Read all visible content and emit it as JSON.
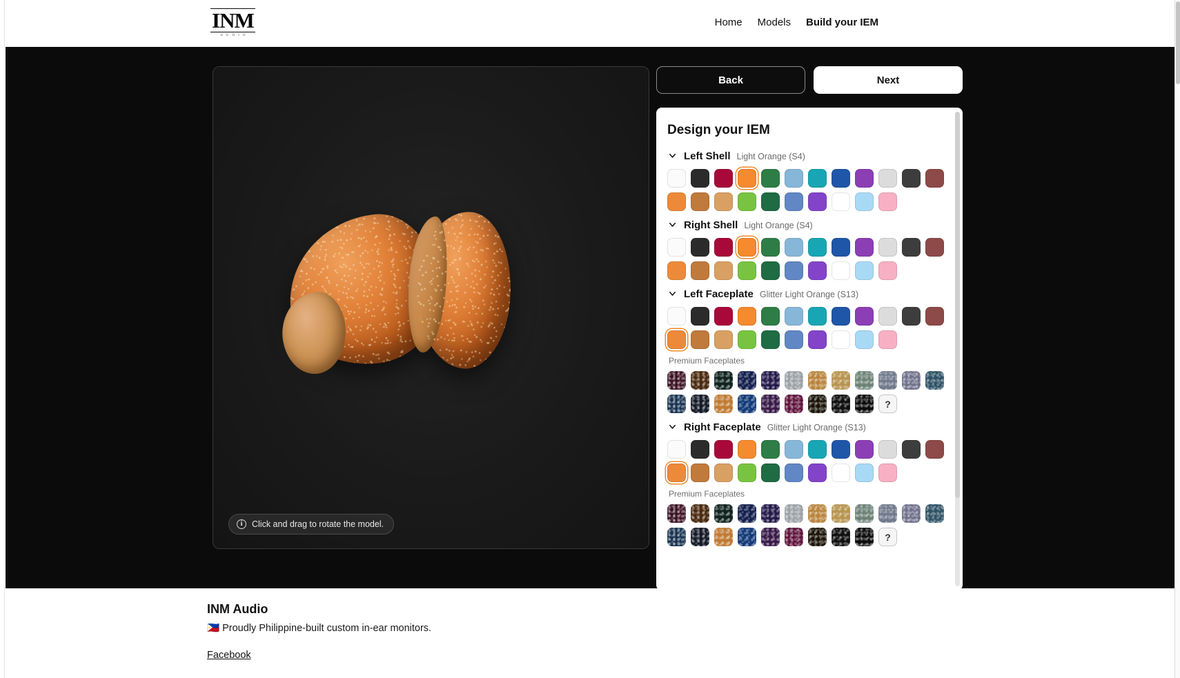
{
  "header": {
    "logo_mark": "INM",
    "logo_sub": "AUDIO",
    "nav": [
      {
        "label": "Home",
        "active": false
      },
      {
        "label": "Models",
        "active": false
      },
      {
        "label": "Build your IEM",
        "active": true
      }
    ]
  },
  "viewer": {
    "hint": "Click and drag to rotate the model.",
    "hint_icon": "info-icon",
    "model": "custom in-ear monitor pair, glitter light orange"
  },
  "controls": {
    "back_label": "Back",
    "next_label": "Next"
  },
  "panel": {
    "title": "Design your IEM",
    "premium_label": "Premium Faceplates",
    "help_label": "?",
    "sections": [
      {
        "name": "Left Shell",
        "value": "Light Orange (S4)",
        "selected_row": 0,
        "selected_index": 3,
        "has_premium": false
      },
      {
        "name": "Right Shell",
        "value": "Light Orange (S4)",
        "selected_row": 0,
        "selected_index": 3,
        "has_premium": false
      },
      {
        "name": "Left Faceplate",
        "value": "Glitter Light Orange (S13)",
        "selected_row": 1,
        "selected_index": 0,
        "has_premium": true
      },
      {
        "name": "Right Faceplate",
        "value": "Glitter Light Orange (S13)",
        "selected_row": 1,
        "selected_index": 0,
        "has_premium": true
      }
    ],
    "palette_row1": [
      "#fbfbfb",
      "#2b2b2b",
      "#a8093a",
      "#f58a2e",
      "#2f7d46",
      "#86b7d8",
      "#18a6b4",
      "#1f56a8",
      "#8c3fb5",
      "#dcdcdc",
      "#3d3d3d",
      "#8d4a48"
    ],
    "palette_row2": [
      "#ed8a3a",
      "#bf7a3c",
      "#d9a063",
      "#78c440",
      "#1f6b43",
      "#6187c4",
      "#8344c9",
      "#ffffff",
      "#a9daf5",
      "#f8b0c4"
    ],
    "premium_row1": [
      "#3a1020",
      "#4a2a10",
      "#10231f",
      "#141f4e",
      "#241a4a",
      "#9aa0a4",
      "#b8843c",
      "#b79450",
      "#6c8277",
      "#707a8c",
      "#6e6f8a",
      "#2e5266"
    ],
    "premium_row2": [
      "#16314f",
      "#141a28",
      "#c07b34",
      "#123a78",
      "#371a48",
      "#5c1038",
      "#1a1408",
      "#101010",
      "#0c0c0c"
    ]
  },
  "footer": {
    "title": "INM Audio",
    "flag": "🇵🇭",
    "tagline": "Proudly Philippine-built custom in-ear monitors.",
    "link": "Facebook"
  }
}
